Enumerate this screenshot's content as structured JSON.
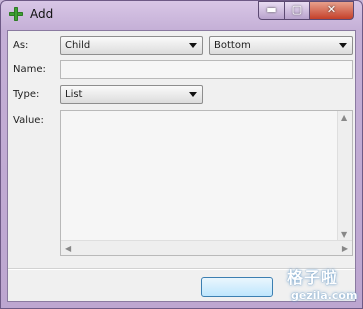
{
  "window": {
    "title": "Add",
    "minimize_glyph": "▬",
    "maximize_glyph": "▢",
    "close_glyph": "✕"
  },
  "form": {
    "as_label": "As:",
    "as_value": "Child",
    "position_value": "Bottom",
    "name_label": "Name:",
    "name_value": "",
    "type_label": "Type:",
    "type_value": "List",
    "value_label": "Value:",
    "value_text": ""
  },
  "scroll": {
    "left_arrow": "◀",
    "right_arrow": "▶",
    "up_arrow": "▲",
    "down_arrow": "▼"
  },
  "watermark": {
    "text": "格子啦",
    "url": "gezila.com"
  }
}
